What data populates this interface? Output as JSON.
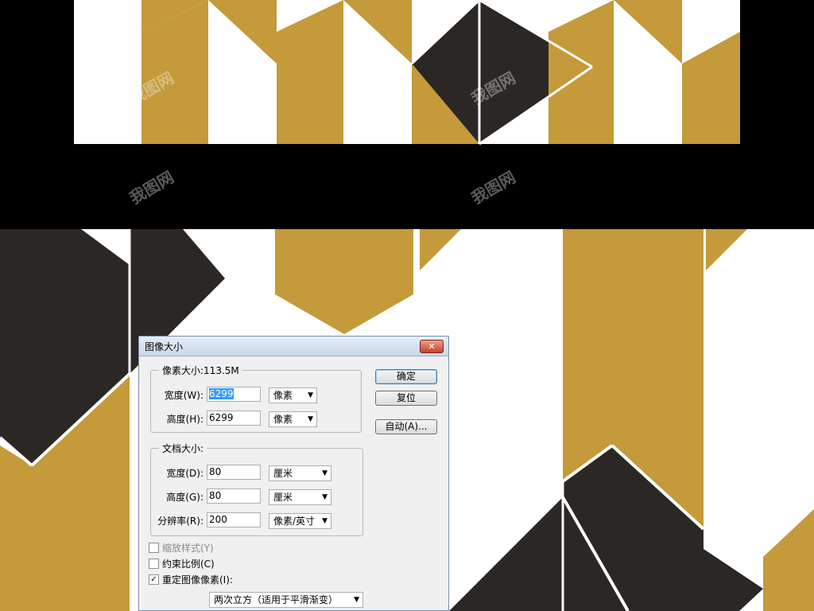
{
  "dialog": {
    "title": "图像大小",
    "close_label": "✕",
    "pixel_dimensions": {
      "legend": "像素大小:113.5M",
      "width_label": "宽度(W):",
      "width_value": "6299",
      "width_unit": "像素",
      "height_label": "高度(H):",
      "height_value": "6299",
      "height_unit": "像素"
    },
    "document_size": {
      "legend": "文档大小:",
      "width_label": "宽度(D):",
      "width_value": "80",
      "width_unit": "厘米",
      "height_label": "高度(G):",
      "height_value": "80",
      "height_unit": "厘米",
      "resolution_label": "分辨率(R):",
      "resolution_value": "200",
      "resolution_unit": "像素/英寸"
    },
    "buttons": {
      "ok": "确定",
      "reset": "复位",
      "auto": "自动(A)..."
    },
    "options": {
      "scale_styles": "缩放样式(Y)",
      "constrain_proportions": "约束比例(C)",
      "resample": "重定图像像素(I):",
      "resample_method": "两次立方（适用于平滑渐变）"
    }
  },
  "watermark": "我图网",
  "colors": {
    "gold": "#c49a3a",
    "dark": "#2a2724",
    "band": "#000000"
  }
}
